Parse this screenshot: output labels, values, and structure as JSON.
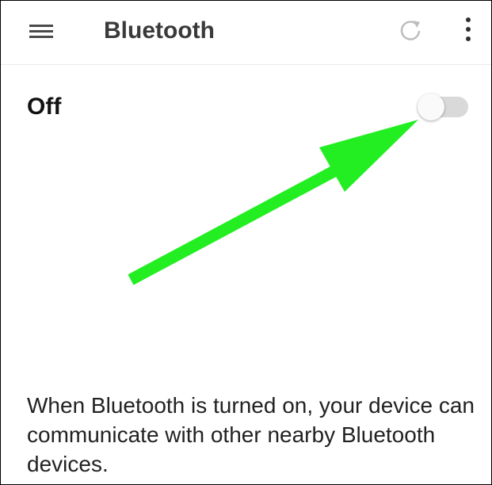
{
  "app_bar": {
    "title": "Bluetooth",
    "icons": [
      "menu-icon",
      "refresh-icon",
      "more-vert-icon"
    ]
  },
  "bluetooth": {
    "state_label": "Off",
    "enabled": false
  },
  "description": "When Bluetooth is turned on, your device can communicate with other nearby Bluetooth devices.",
  "annotation": {
    "arrow_color": "#22ee22",
    "points_to": "bluetooth-toggle"
  },
  "colors": {
    "title": "#3a3a3a",
    "toggle_track_off": "#d9d9d9",
    "icon": "#4a4a4a",
    "refresh_icon": "#bdbdbd"
  }
}
